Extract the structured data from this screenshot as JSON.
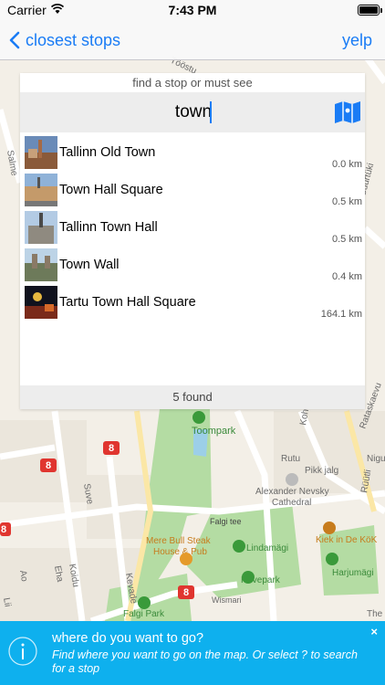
{
  "status": {
    "carrier": "Carrier",
    "time": "7:43 PM"
  },
  "nav": {
    "back_label": "closest stops",
    "right_label": "yelp"
  },
  "search": {
    "hint": "find a stop or must see",
    "value": "town"
  },
  "results": [
    {
      "name": "Tallinn Old Town",
      "distance": "0.0 km"
    },
    {
      "name": "Town Hall Square",
      "distance": "0.5 km"
    },
    {
      "name": "Tallinn Town Hall",
      "distance": "0.5 km"
    },
    {
      "name": "Town Wall",
      "distance": "0.4 km"
    },
    {
      "name": "Tartu Town Hall Square",
      "distance": "164.1 km"
    }
  ],
  "found_text": "5 found",
  "map": {
    "labels": {
      "toompark": "Toompark",
      "kohtu": "Kohtu",
      "rataskaevu": "Rataskaevu",
      "rutu": "Rutu",
      "nig": "Nigu",
      "pikk_jalg": "Pikk jalg",
      "cathedral_1": "Alexander Nevsky",
      "cathedral_2": "Cathedral",
      "ruutli": "Rüütli",
      "falgi_tee": "Falgi tee",
      "steak_1": "Mere Bull Steak",
      "steak_2": "House & Pub",
      "lindamagi": "Lindamägi",
      "kiek": "Kiek in De KöK",
      "harjumagi": "Harjumägi",
      "hirvepark": "Hirvepark",
      "suve": "Suve",
      "eha": "Eha",
      "koidu": "Koidu",
      "kevade": "Kevade",
      "wismari": "Wismari",
      "falgi_park": "Falgi Park",
      "ao": "Ao",
      "lii": "Lii",
      "the": "The",
      "salme": "Salme",
      "suurtuki": "Suurtüki",
      "toostuse": "Tööstu"
    },
    "route_badges": [
      "8",
      "8",
      "8",
      "8"
    ]
  },
  "banner": {
    "title": "where do you want to go?",
    "text": "Find where you want to go on the map. Or select ? to search for a stop",
    "close": "×"
  },
  "colors": {
    "accent": "#1a7cf5",
    "banner": "#0eb0ee",
    "park": "#a8d59a",
    "route_badge": "#e0352f"
  }
}
